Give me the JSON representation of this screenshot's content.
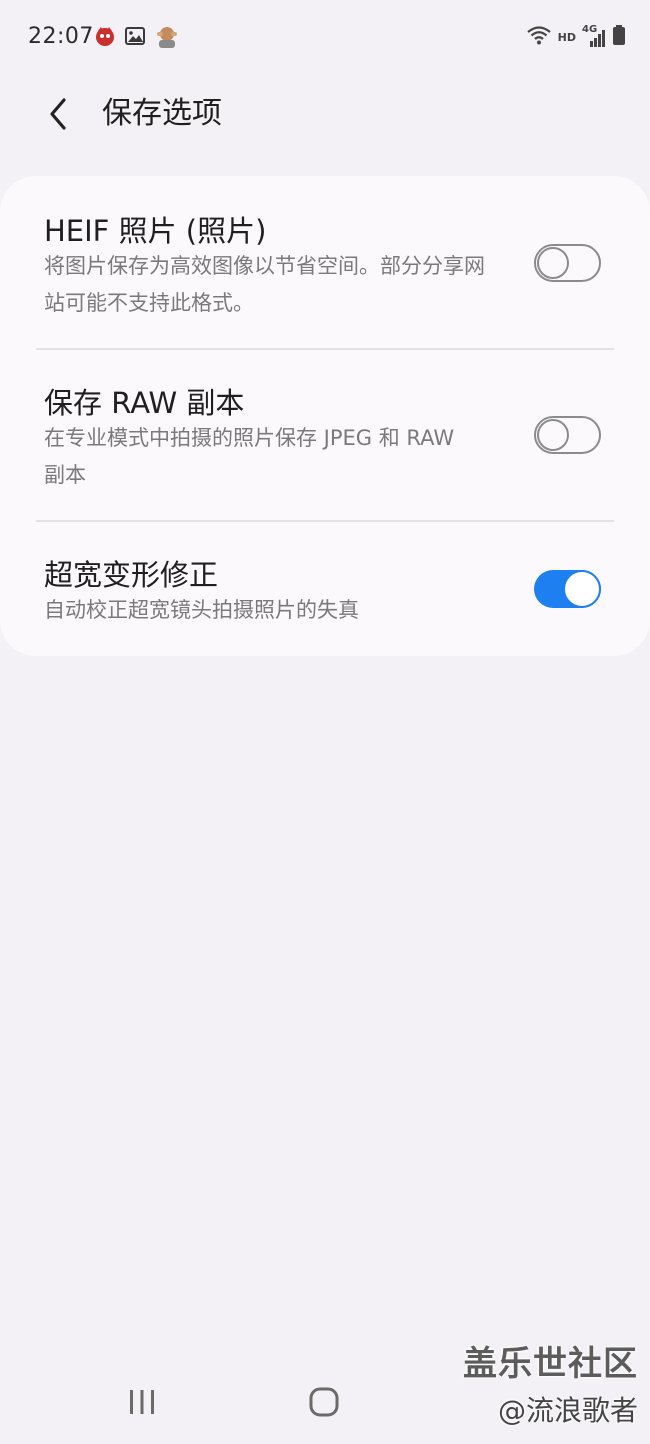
{
  "status_bar": {
    "time": "22:07",
    "left_icons": [
      "game-icon",
      "gallery-icon",
      "emoji-icon"
    ],
    "right_icons": [
      "wifi-icon",
      "hd-icon",
      "signal-4g-icon",
      "battery-icon"
    ],
    "hd": "HD",
    "network": "4G"
  },
  "header": {
    "back_icon": "chevron-left-icon",
    "title": "保存选项"
  },
  "settings": [
    {
      "title": "HEIF 照片 (照片)",
      "description": "将图片保存为高效图像以节省空间。部分分享网站可能不支持此格式。",
      "enabled": false
    },
    {
      "title": "保存 RAW 副本",
      "description": "在专业模式中拍摄的照片保存 JPEG 和 RAW 副本",
      "enabled": false
    },
    {
      "title": "超宽变形修正",
      "description": "自动校正超宽镜头拍摄照片的失真",
      "enabled": true
    }
  ],
  "nav_bar": {
    "recents_icon": "recents-icon",
    "home_icon": "home-icon"
  },
  "watermark": {
    "line1": "盖乐世社区",
    "line2": "@流浪歌者"
  },
  "colors": {
    "background": "#f3f1f5",
    "card": "#fbf9fc",
    "accent": "#1e7ff0",
    "secondary_text": "#7a7a7a"
  }
}
